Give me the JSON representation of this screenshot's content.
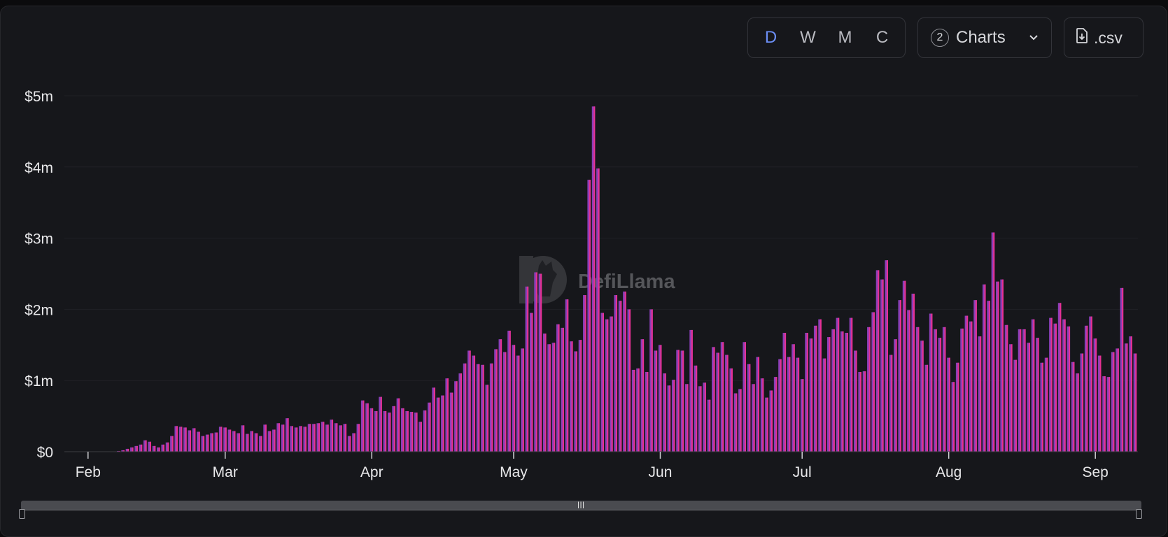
{
  "toolbar": {
    "periods": [
      "D",
      "W",
      "M",
      "C"
    ],
    "active_period": "D",
    "charts_count": "2",
    "charts_label": "Charts",
    "csv_label": ".csv"
  },
  "watermark": {
    "text": "DefiLlama"
  },
  "colors": {
    "bar_fill": "#8a3fb8",
    "bar_edge": "#ff2d8a",
    "accent": "#6b8ef5",
    "background": "#16171b"
  },
  "chart_data": {
    "type": "bar",
    "title": "",
    "xlabel": "",
    "ylabel": "",
    "x_start": "2024-01-27",
    "x_end": "2024-09-10",
    "x_tick_labels": [
      "Feb",
      "Mar",
      "Apr",
      "May",
      "Jun",
      "Jul",
      "Aug",
      "Sep"
    ],
    "y_tick_labels": [
      "$0",
      "$1m",
      "$2m",
      "$3m",
      "$4m",
      "$5m"
    ],
    "ylim": [
      0,
      5000000
    ],
    "grid": true,
    "legend": "none",
    "values_millions": [
      0.01,
      0.02,
      0.04,
      0.06,
      0.08,
      0.1,
      0.16,
      0.14,
      0.08,
      0.06,
      0.1,
      0.13,
      0.22,
      0.36,
      0.35,
      0.34,
      0.3,
      0.33,
      0.28,
      0.22,
      0.24,
      0.26,
      0.27,
      0.35,
      0.34,
      0.31,
      0.29,
      0.26,
      0.37,
      0.25,
      0.29,
      0.26,
      0.22,
      0.38,
      0.29,
      0.31,
      0.4,
      0.38,
      0.47,
      0.36,
      0.34,
      0.36,
      0.35,
      0.39,
      0.39,
      0.4,
      0.42,
      0.38,
      0.45,
      0.4,
      0.37,
      0.39,
      0.22,
      0.26,
      0.39,
      0.72,
      0.68,
      0.61,
      0.57,
      0.77,
      0.57,
      0.55,
      0.64,
      0.75,
      0.61,
      0.57,
      0.56,
      0.55,
      0.42,
      0.58,
      0.69,
      0.9,
      0.76,
      0.79,
      1.03,
      0.83,
      0.99,
      1.1,
      1.24,
      1.42,
      1.35,
      1.23,
      1.22,
      0.94,
      1.24,
      1.44,
      1.58,
      1.4,
      1.7,
      1.5,
      1.35,
      1.45,
      2.32,
      1.95,
      2.52,
      2.5,
      1.66,
      1.51,
      1.53,
      1.79,
      1.74,
      2.14,
      1.55,
      1.41,
      1.57,
      2.2,
      3.82,
      4.85,
      3.98,
      1.95,
      1.86,
      1.9,
      2.2,
      2.12,
      2.25,
      2.0,
      1.15,
      1.17,
      1.58,
      1.12,
      2.0,
      1.42,
      1.5,
      1.1,
      0.93,
      1.01,
      1.43,
      1.42,
      0.95,
      1.71,
      1.21,
      0.92,
      0.97,
      0.73,
      1.47,
      1.39,
      1.54,
      1.36,
      1.17,
      0.82,
      0.88,
      1.54,
      1.23,
      0.95,
      1.33,
      1.03,
      0.76,
      0.86,
      1.05,
      1.3,
      1.67,
      1.33,
      1.51,
      1.32,
      1.02,
      1.67,
      1.59,
      1.77,
      1.86,
      1.31,
      1.61,
      1.72,
      1.88,
      1.69,
      1.67,
      1.88,
      1.42,
      1.12,
      1.13,
      1.75,
      1.96,
      2.55,
      2.42,
      2.69,
      1.36,
      1.58,
      2.13,
      2.4,
      1.99,
      2.22,
      1.75,
      1.56,
      1.22,
      1.94,
      1.72,
      1.6,
      1.75,
      1.32,
      0.98,
      1.25,
      1.73,
      1.91,
      1.83,
      2.13,
      1.62,
      2.35,
      2.12,
      3.08,
      2.39,
      2.42,
      1.78,
      1.51,
      1.29,
      1.72,
      1.72,
      1.53,
      1.86,
      1.6,
      1.25,
      1.32,
      1.88,
      1.8,
      2.09,
      1.86,
      1.76,
      1.26,
      1.1,
      1.38,
      1.77,
      1.9,
      1.59,
      1.35,
      1.06,
      1.05,
      1.4,
      1.45,
      2.3,
      1.52,
      1.62,
      1.38
    ]
  }
}
